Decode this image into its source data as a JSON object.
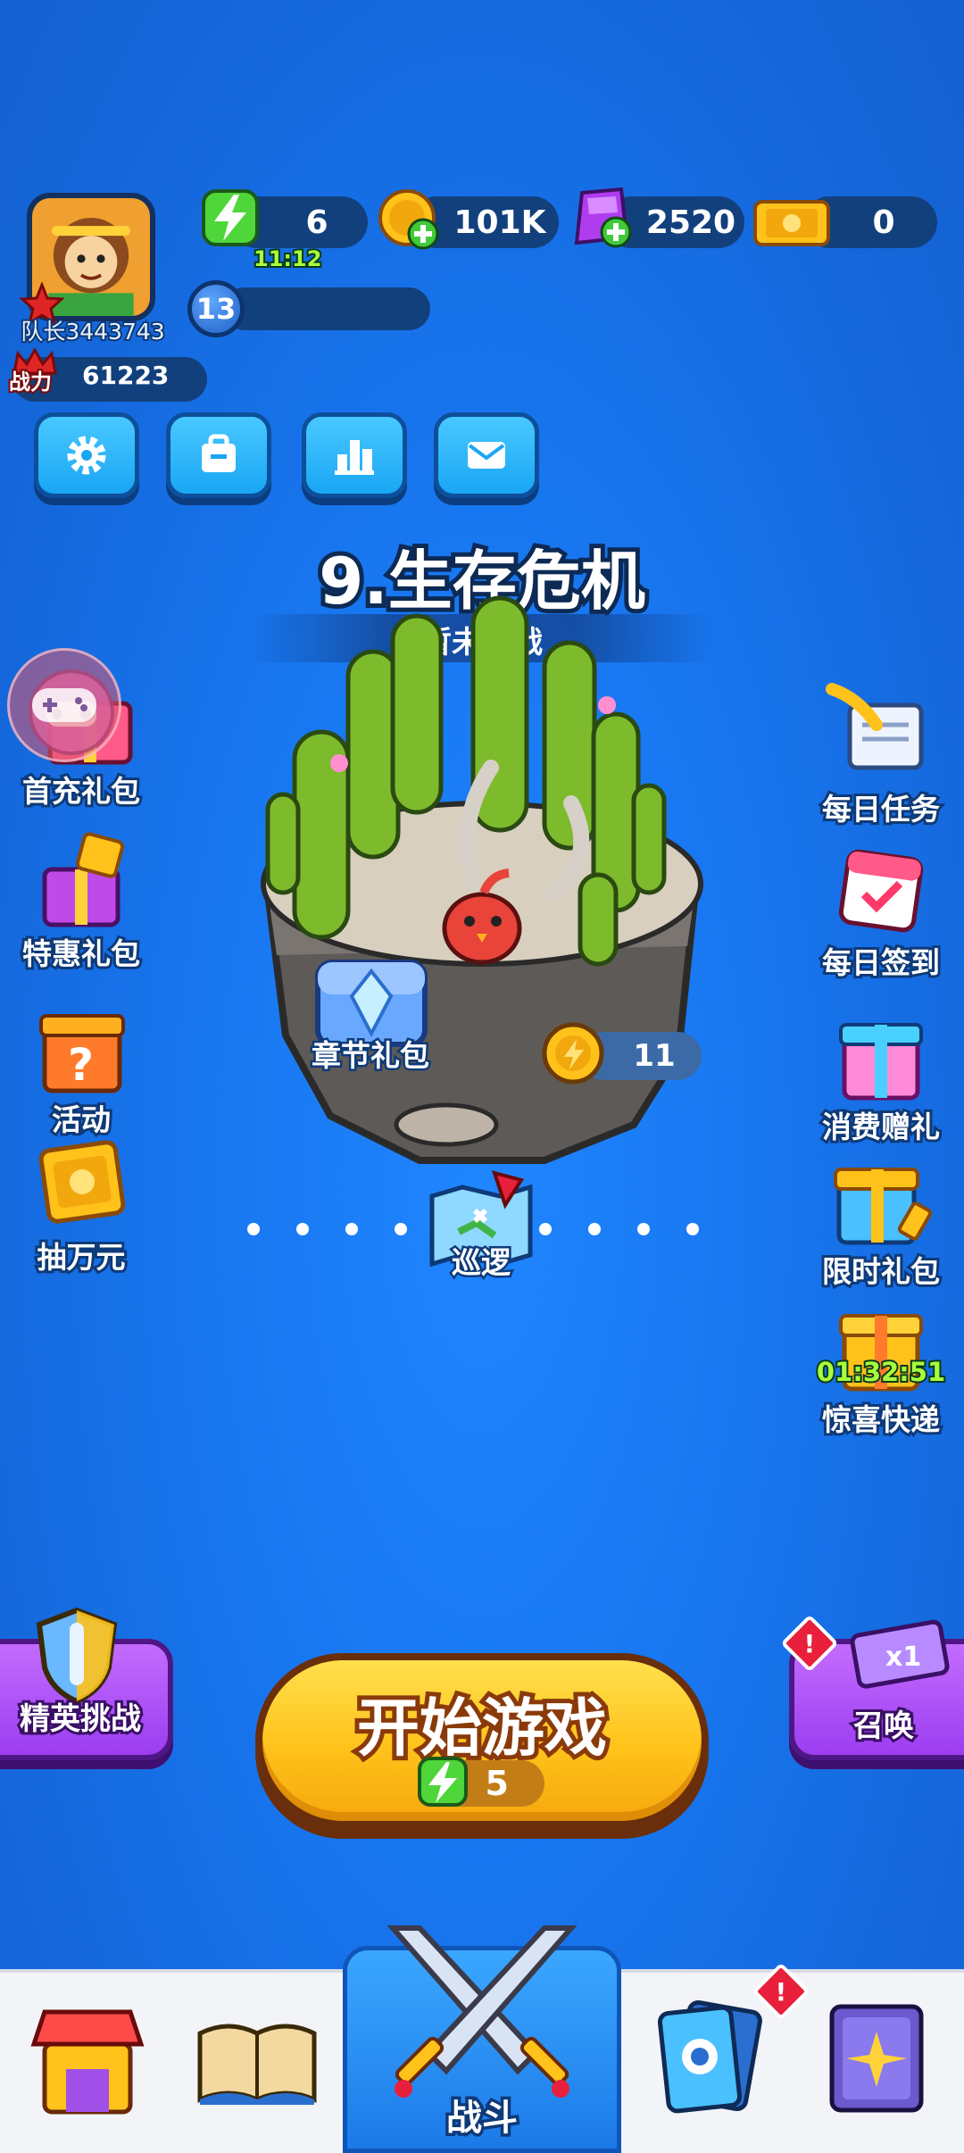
{
  "player": {
    "name": "队长3443743",
    "level": "13",
    "power_label": "战力",
    "power_value": "61223"
  },
  "resources": {
    "energy": "6",
    "energy_timer": "11:12",
    "coins": "101K",
    "gems": "2520",
    "tickets": "0"
  },
  "chapter": {
    "title": "9.生存危机",
    "status": "暂未挑战",
    "chest_label": "章节礼包",
    "coin_reward": "11",
    "patrol_label": "巡逻"
  },
  "left_menu": [
    {
      "label": "首充礼包"
    },
    {
      "label": "特惠礼包"
    },
    {
      "label": "活动"
    },
    {
      "label": "抽万元"
    }
  ],
  "right_menu": [
    {
      "label": "每日任务"
    },
    {
      "label": "每日签到"
    },
    {
      "label": "消费赠礼"
    },
    {
      "label": "限时礼包"
    },
    {
      "label": "惊喜快递",
      "timer": "01:32:51"
    }
  ],
  "actions": {
    "start": "开始游戏",
    "start_cost": "5",
    "elite": "精英挑战",
    "summon": "召唤",
    "alert": "!"
  },
  "nav": {
    "battle": "战斗",
    "alert": "!"
  },
  "colors": {
    "background": "#1877f0",
    "start_button": "#ffc21a",
    "purple_button": "#a64bf4",
    "energy_green": "#a9ff3d"
  },
  "icons": [
    "settings-icon",
    "shop-bag-icon",
    "leaderboard-icon",
    "mail-icon",
    "energy-icon",
    "coin-icon",
    "gem-icon",
    "ticket-icon"
  ]
}
